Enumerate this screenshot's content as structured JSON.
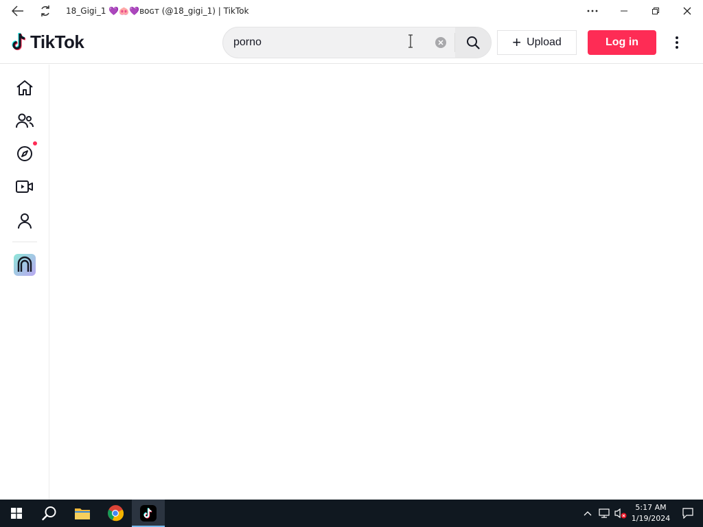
{
  "window": {
    "title": "18_Gigi_1 💜🐽💜ʙᴏɢᴛ (@18_gigi_1) | TikTok"
  },
  "header": {
    "logo_text": "TikTok",
    "search": {
      "value": "porno",
      "placeholder": "Search"
    },
    "upload_label": "Upload",
    "upload_plus": "+",
    "login_label": "Log in"
  },
  "sidebar": {
    "items": [
      {
        "id": "home",
        "icon": "home-icon"
      },
      {
        "id": "following",
        "icon": "people-icon"
      },
      {
        "id": "explore",
        "icon": "compass-icon",
        "has_dot": true
      },
      {
        "id": "live",
        "icon": "video-camera-icon"
      },
      {
        "id": "profile",
        "icon": "user-icon"
      },
      {
        "id": "effect-house",
        "icon": "effect-house-icon"
      }
    ]
  },
  "taskbar": {
    "time": "5:17 AM",
    "date": "1/19/2024"
  },
  "colors": {
    "accent": "#fe2c55",
    "text": "#161823",
    "taskbar": "#101820"
  }
}
